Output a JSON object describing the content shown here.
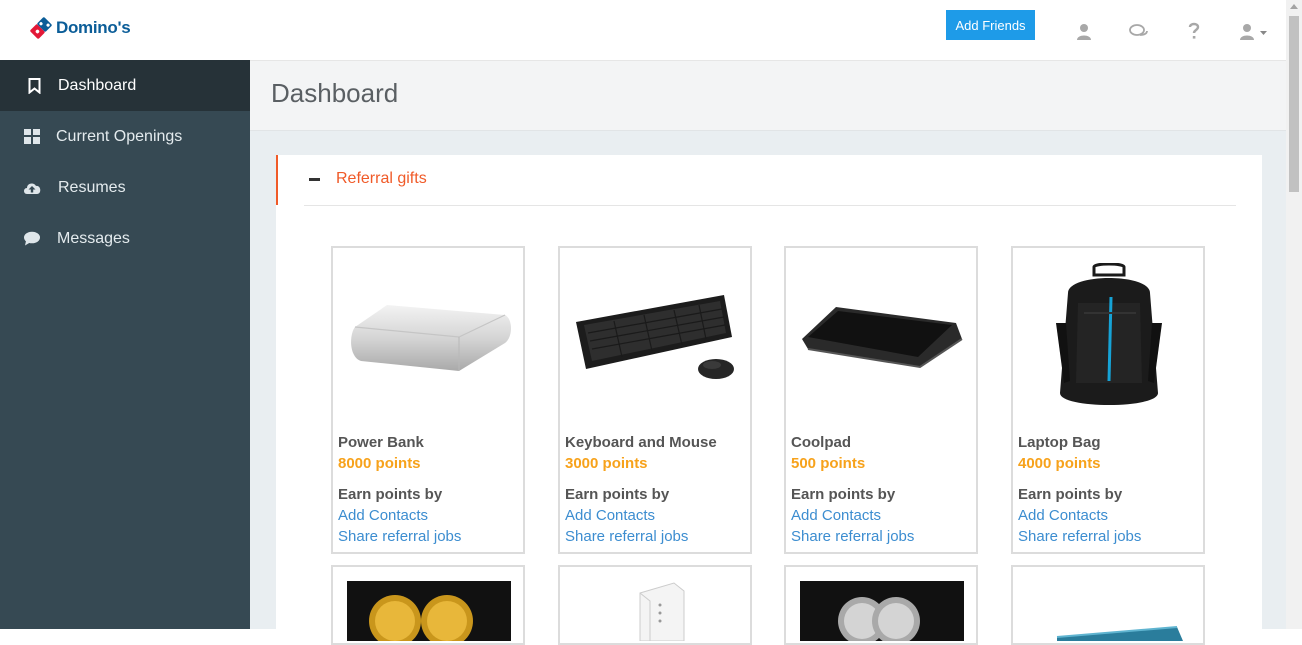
{
  "brand": {
    "name": "Domino's",
    "colors": {
      "blue": "#0b5d98",
      "red": "#e31837"
    }
  },
  "topbar": {
    "add_friends_label": "Add Friends",
    "icons": [
      "user-icon",
      "chat-icon",
      "help-icon",
      "account-menu-icon"
    ]
  },
  "sidebar": {
    "items": [
      {
        "label": "Dashboard",
        "icon": "bookmark-icon",
        "active": true
      },
      {
        "label": "Current Openings",
        "icon": "grid-icon",
        "active": false
      },
      {
        "label": "Resumes",
        "icon": "cloud-upload-icon",
        "active": false
      },
      {
        "label": "Messages",
        "icon": "chat-bubble-icon",
        "active": false
      }
    ]
  },
  "page": {
    "title": "Dashboard"
  },
  "panel": {
    "title": "Referral gifts",
    "accent_color": "#f05a28",
    "gifts": [
      {
        "name": "Power Bank",
        "points": "8000 points",
        "earn_label": "Earn points by",
        "link1": "Add Contacts",
        "link2": "Share referral jobs",
        "image": "power-bank"
      },
      {
        "name": "Keyboard and Mouse",
        "points": "3000 points",
        "earn_label": "Earn points by",
        "link1": "Add Contacts",
        "link2": "Share referral jobs",
        "image": "keyboard-mouse"
      },
      {
        "name": "Coolpad",
        "points": "500 points",
        "earn_label": "Earn points by",
        "link1": "Add Contacts",
        "link2": "Share referral jobs",
        "image": "coolpad"
      },
      {
        "name": "Laptop Bag",
        "points": "4000 points",
        "earn_label": "Earn points by",
        "link1": "Add Contacts",
        "link2": "Share referral jobs",
        "image": "laptop-bag"
      }
    ],
    "second_row_images": [
      "gold-coins",
      "router",
      "silver-coins",
      "card"
    ]
  }
}
